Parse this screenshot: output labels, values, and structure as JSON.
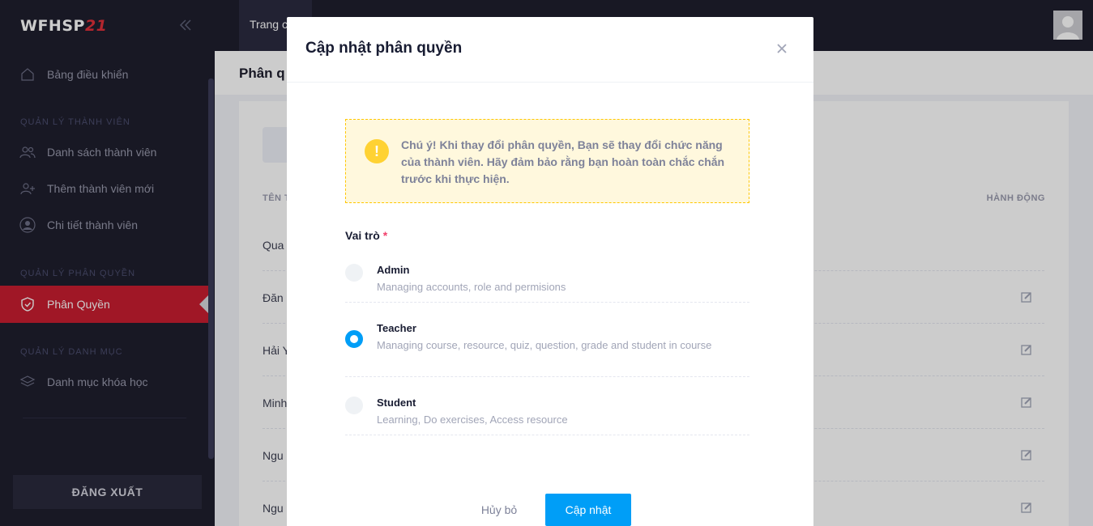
{
  "app": {
    "logo_main": "WFHSP",
    "logo_accent": "21"
  },
  "sidebar": {
    "dashboard": "Bảng điều khiển",
    "sections": [
      {
        "label": "QUẢN LÝ THÀNH VIÊN"
      },
      {
        "label": "QUẢN LÝ PHÂN QUYỀN"
      },
      {
        "label": "QUẢN LÝ DANH MỤC"
      }
    ],
    "items": [
      {
        "label": "Danh sách thành viên"
      },
      {
        "label": "Thêm thành viên mới"
      },
      {
        "label": "Chi tiết thành viên"
      },
      {
        "label": "Phân Quyền"
      },
      {
        "label": "Danh mục khóa học"
      }
    ],
    "logout": "ĐĂNG XUẤT"
  },
  "topbar": {
    "tab": "Trang c"
  },
  "page": {
    "title": "Phân q",
    "table": {
      "header_left": "TÊN T",
      "header_right": "HÀNH ĐỘNG",
      "rows": [
        {
          "name": "Qua"
        },
        {
          "name": "Đăn"
        },
        {
          "name": "Hải Y"
        },
        {
          "name": "Minh"
        },
        {
          "name": "Ngu"
        },
        {
          "name": "Ngu"
        }
      ]
    }
  },
  "modal": {
    "title": "Cập nhật phân quyền",
    "notice": "Chú ý! Khi thay đổi phân quyền, Bạn sẽ thay đổi chức năng của thành viên. Hãy đảm bảo rằng bạn hoàn toàn chắc chắn trước khi thực hiện.",
    "role_label": "Vai trò",
    "required_mark": "*",
    "options": [
      {
        "title": "Admin",
        "desc": "Managing accounts, role and permisions",
        "checked": false
      },
      {
        "title": "Teacher",
        "desc": "Managing course, resource, quiz, question, grade and student in course",
        "checked": true
      },
      {
        "title": "Student",
        "desc": "Learning, Do exercises, Access resource",
        "checked": false
      }
    ],
    "cancel": "Hủy bỏ",
    "submit": "Cập nhật"
  },
  "colors": {
    "sidebar_bg": "#1e1e2d",
    "active_red": "#c81d30",
    "primary_blue": "#009ef7",
    "warning_bg": "#fff8dd",
    "warning_border": "#ffc700"
  }
}
